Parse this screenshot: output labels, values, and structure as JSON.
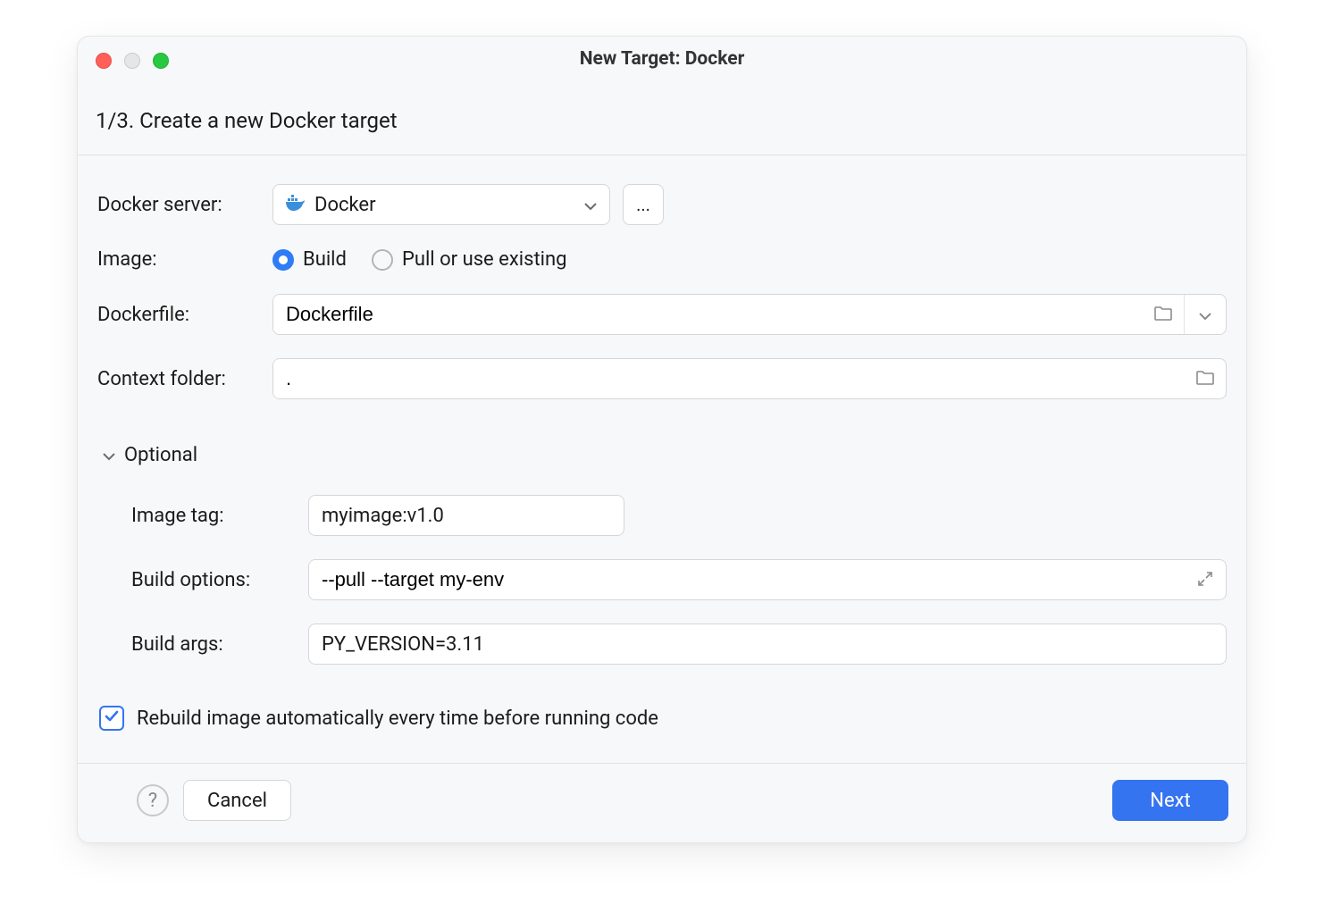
{
  "window": {
    "title": "New Target: Docker",
    "step_heading": "1/3. Create a new Docker target"
  },
  "labels": {
    "docker_server": "Docker server:",
    "image": "Image:",
    "dockerfile": "Dockerfile:",
    "context_folder": "Context folder:",
    "optional_section": "Optional",
    "image_tag": "Image tag:",
    "build_options": "Build options:",
    "build_args": "Build args:"
  },
  "docker_server": {
    "selected": "Docker",
    "more_button": "..."
  },
  "image_mode": {
    "value": "build",
    "options": {
      "build": "Build",
      "pull": "Pull or use existing"
    }
  },
  "dockerfile": "Dockerfile",
  "context_folder": ".",
  "optional": {
    "image_tag": "myimage:v1.0",
    "build_options": "--pull --target my-env",
    "build_args": "PY_VERSION=3.11"
  },
  "auto_rebuild": {
    "checked": true,
    "label": "Rebuild image automatically every time before running code"
  },
  "footer": {
    "help": "?",
    "cancel": "Cancel",
    "next": "Next"
  },
  "icons": {
    "docker": "docker-icon",
    "chevron_down": "chevron-down-icon",
    "more": "more-icon",
    "folder": "folder-icon",
    "expand": "expand-icon",
    "checkmark": "checkmark-icon"
  }
}
